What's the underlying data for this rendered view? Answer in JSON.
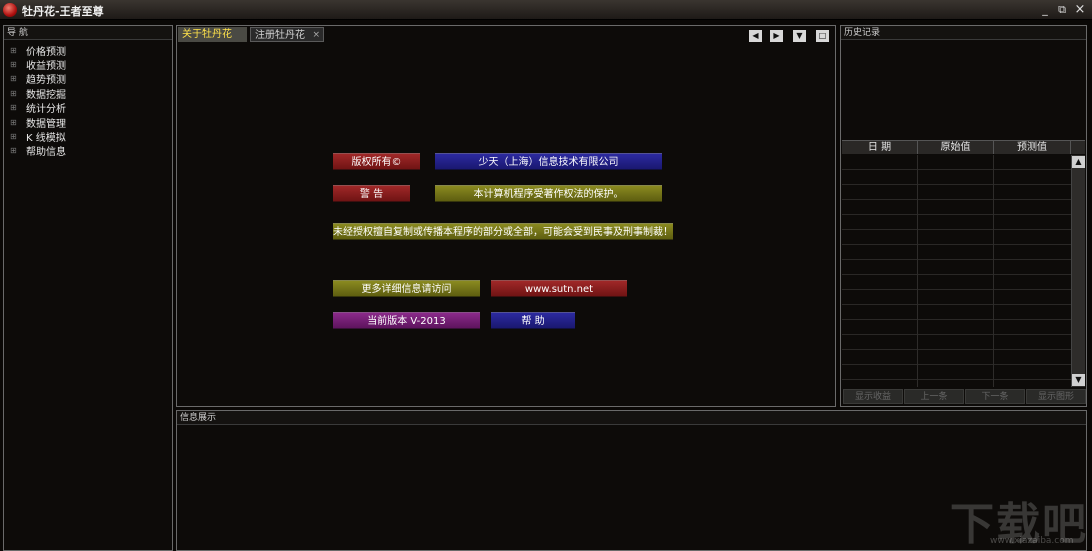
{
  "window": {
    "title": "牡丹花-王者至尊",
    "minimize_glyph": "_",
    "restore_glyph": "⧉",
    "close_glyph": "×"
  },
  "nav": {
    "title": "导 航",
    "items": [
      {
        "label": "价格预测"
      },
      {
        "label": "收益预测"
      },
      {
        "label": "趋势预测"
      },
      {
        "label": "数据挖掘"
      },
      {
        "label": "统计分析"
      },
      {
        "label": "数据管理"
      },
      {
        "label": "K 线模拟"
      },
      {
        "label": "帮助信息"
      }
    ]
  },
  "tabs": [
    {
      "label": "关于牡丹花",
      "active": true
    },
    {
      "label": "注册牡丹花",
      "close": "×",
      "active": false
    }
  ],
  "about": {
    "copyright_label": "版权所有©",
    "company": "少天（上海）信息技术有限公司",
    "warning_label": "警 告",
    "protection": "本计算机程序受著作权法的保护。",
    "notice": "未经授权擅自复制或传播本程序的部分或全部，可能会受到民事及刑事制裁！",
    "more_info": "更多详细信息请访问",
    "website": "www.sutn.net",
    "version": "当前版本  V-2013",
    "help": "帮  助"
  },
  "history": {
    "title": "历史记录",
    "columns": [
      "日  期",
      "原始值",
      "预测值"
    ],
    "buttons": [
      "显示收益",
      "上一条",
      "下一条",
      "显示图形"
    ]
  },
  "info": {
    "title": "信息展示"
  },
  "watermark": {
    "text": "下载吧",
    "url": "www.xiazaiba.com"
  }
}
